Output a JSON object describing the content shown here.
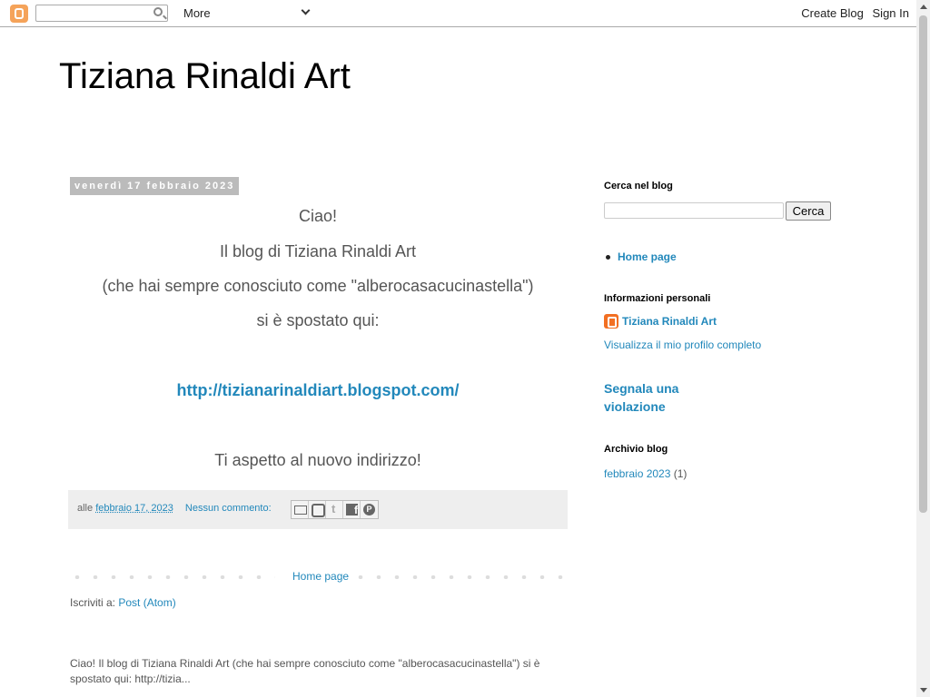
{
  "navbar": {
    "more_label": "More",
    "create_blog": "Create Blog",
    "sign_in": "Sign In"
  },
  "header": {
    "title": "Tiziana Rinaldi Art"
  },
  "post": {
    "date": "venerdì 17 febbraio 2023",
    "lines": [
      "Ciao!",
      "Il blog di Tiziana Rinaldi Art",
      "(che hai sempre conosciuto come \"alberocasacucinastella\")",
      "si è spostato qui:",
      "http://tizianarinaldiart.blogspot.com/",
      "Ti aspetto al nuovo indirizzo!"
    ],
    "footer": {
      "prefix": "alle",
      "timestamp": "febbraio 17, 2023",
      "comments": "Nessun commento:"
    }
  },
  "pager": {
    "home": "Home page"
  },
  "subscribe": {
    "prefix": "Iscriviti a:",
    "link": "Post (Atom)"
  },
  "snippet": "Ciao! Il blog di Tiziana Rinaldi Art  (che hai sempre conosciuto come \"alberocasacucinastella\")  si è spostato qui: http://tizia...",
  "sidebar": {
    "search_title": "Cerca nel blog",
    "search_button": "Cerca",
    "pages": [
      "Home page"
    ],
    "profile_title": "Informazioni personali",
    "profile_name": "Tiziana Rinaldi Art",
    "profile_link": "Visualizza il mio profilo completo",
    "report": "Segnala una violazione",
    "archive_title": "Archivio blog",
    "archive_month": "febbraio 2023",
    "archive_count": "(1)"
  }
}
